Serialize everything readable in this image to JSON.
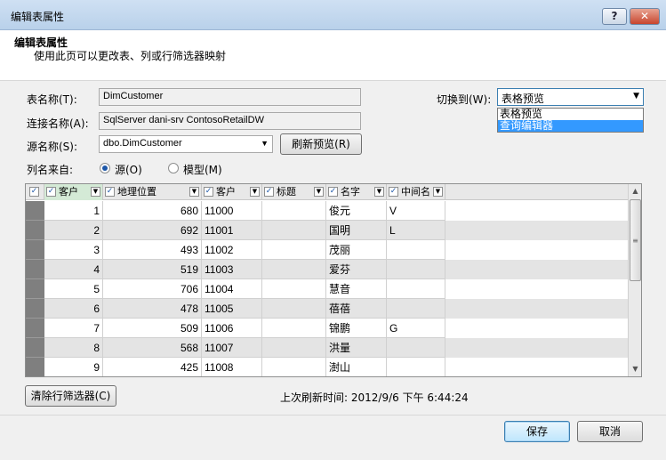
{
  "window": {
    "title": "编辑表属性",
    "help_label": "?",
    "close_label": "✕"
  },
  "header": {
    "title": "编辑表属性",
    "subtitle": "使用此页可以更改表、列或行筛选器映射"
  },
  "form": {
    "table_name_label": "表名称(T):",
    "table_name_value": "DimCustomer",
    "connection_label": "连接名称(A):",
    "connection_value": "SqlServer dani-srv ContosoRetailDW",
    "source_label": "源名称(S):",
    "source_value": "dbo.DimCustomer",
    "refresh_label": "刷新预览(R)",
    "column_from_label": "列名来自:",
    "radio_source_label": "源(O)",
    "radio_model_label": "模型(M)",
    "switch_label": "切换到(W):",
    "switch_value": "表格预览",
    "switch_options": [
      "表格预览",
      "查询编辑器"
    ]
  },
  "grid": {
    "columns": [
      "客户",
      "地理位置",
      "客户",
      "标题",
      "名字",
      "中间名"
    ],
    "rows": [
      [
        "1",
        "680",
        "11000",
        "",
        "俊元",
        "V"
      ],
      [
        "2",
        "692",
        "11001",
        "",
        "国明",
        "L"
      ],
      [
        "3",
        "493",
        "11002",
        "",
        "茂丽",
        ""
      ],
      [
        "4",
        "519",
        "11003",
        "",
        "爱芬",
        ""
      ],
      [
        "5",
        "706",
        "11004",
        "",
        "慧音",
        ""
      ],
      [
        "6",
        "478",
        "11005",
        "",
        "蓓蓓",
        ""
      ],
      [
        "7",
        "509",
        "11006",
        "",
        "锦鹏",
        "G"
      ],
      [
        "8",
        "568",
        "11007",
        "",
        "洪量",
        ""
      ],
      [
        "9",
        "425",
        "11008",
        "",
        "澍山",
        ""
      ]
    ]
  },
  "footer_info": {
    "clear_filter_label": "清除行筛选器(C)",
    "last_refresh_label": "上次刷新时间: 2012/9/6 下午 6:44:24"
  },
  "actions": {
    "save_label": "保存",
    "cancel_label": "取消"
  }
}
